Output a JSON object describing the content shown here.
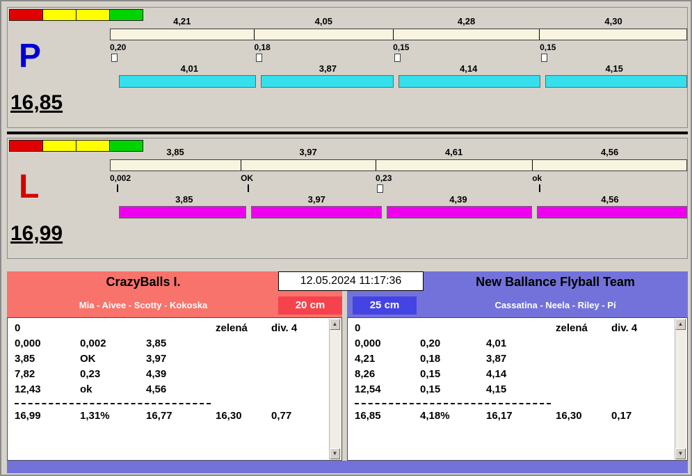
{
  "lanes": [
    {
      "id": "P",
      "letter": "P",
      "total": "16,85",
      "pass_times": [
        "4,21",
        "4,05",
        "4,28",
        "4,30"
      ],
      "crossings": [
        "0,20",
        "0,18",
        "0,15",
        "0,15"
      ],
      "dog_times": [
        "4,01",
        "3,87",
        "4,14",
        "4,15"
      ]
    },
    {
      "id": "L",
      "letter": "L",
      "total": "16,99",
      "pass_times": [
        "3,85",
        "3,97",
        "4,61",
        "4,56"
      ],
      "crossings": [
        "0,002",
        "OK",
        "0,23",
        "ok"
      ],
      "dog_times": [
        "3,85",
        "3,97",
        "4,39",
        "4,56"
      ]
    }
  ],
  "scoreboard": {
    "datetime": "12.05.2024 11:17:36",
    "left": {
      "team": "CrazyBalls I.",
      "dogs": "Mia - Aivee - Scotty - Kokoska",
      "height": "20 cm",
      "rows": [
        [
          "0",
          "",
          "",
          "zelená",
          "div. 4"
        ],
        [
          "0,000",
          "0,002",
          "3,85",
          "",
          ""
        ],
        [
          "3,85",
          "OK",
          "3,97",
          "",
          ""
        ],
        [
          "7,82",
          "0,23",
          "4,39",
          "",
          ""
        ],
        [
          "12,43",
          "ok",
          "4,56",
          "",
          ""
        ]
      ],
      "totals": [
        "16,99",
        "1,31%",
        "16,77",
        "16,30",
        "0,77"
      ]
    },
    "right": {
      "team": "New Ballance Flyball Team",
      "dogs": "Cassatina - Neela - Riley - Pí",
      "height": "25 cm",
      "rows": [
        [
          "0",
          "",
          "",
          "zelená",
          "div. 4"
        ],
        [
          "0,000",
          "0,20",
          "4,01",
          "",
          ""
        ],
        [
          "4,21",
          "0,18",
          "3,87",
          "",
          ""
        ],
        [
          "8,26",
          "0,15",
          "4,14",
          "",
          ""
        ],
        [
          "12,54",
          "0,15",
          "4,15",
          "",
          ""
        ]
      ],
      "totals": [
        "16,85",
        "4,18%",
        "16,17",
        "16,30",
        "0,17"
      ]
    }
  },
  "icons": {
    "scroll_up": "▲",
    "scroll_down": "▼"
  },
  "colors": {
    "lane_p_bar": "#35dfec",
    "lane_l_bar": "#ee00ee",
    "lane_p_letter": "#0000d4",
    "lane_l_letter": "#d40000",
    "pass_bar": "#f8f4e0",
    "team_left_header": "#f8736b",
    "team_right_header": "#7272da",
    "badge_left": "#f4434c",
    "badge_right": "#4444e4",
    "light_red": "#e10000",
    "light_yellow": "#ffff00",
    "light_green": "#00d400"
  }
}
